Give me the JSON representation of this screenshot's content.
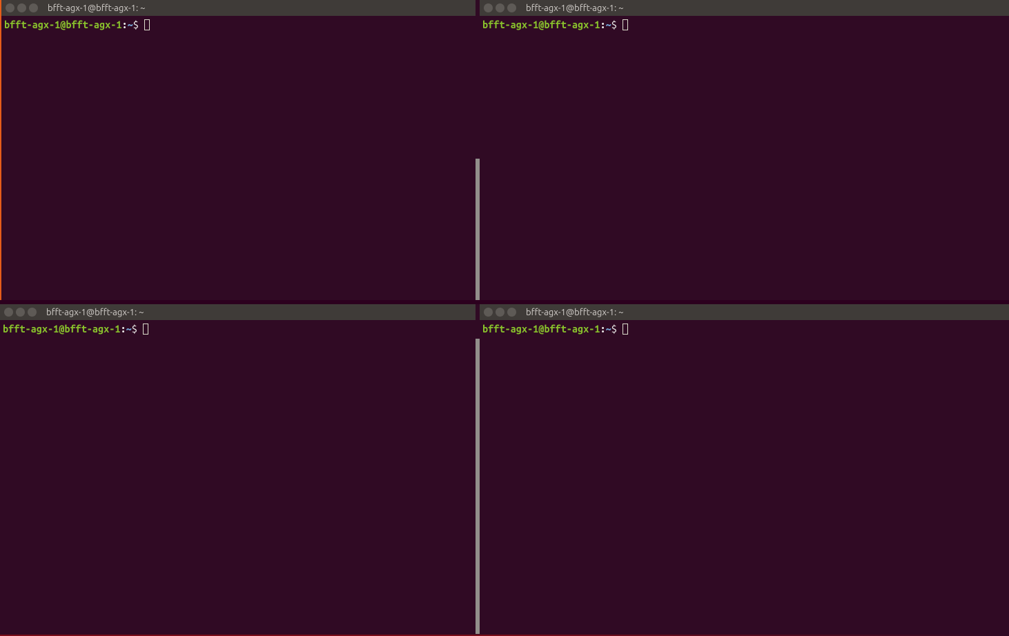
{
  "panes": {
    "tl": {
      "title": "bfft-agx-1@bfft-agx-1: ~",
      "prompt_user": "bfft-agx-1@bfft-agx-1",
      "prompt_colon": ":",
      "prompt_path": "~",
      "prompt_dollar": "$"
    },
    "tr": {
      "title": "bfft-agx-1@bfft-agx-1: ~",
      "prompt_user": "bfft-agx-1@bfft-agx-1",
      "prompt_colon": ":",
      "prompt_path": "~",
      "prompt_dollar": "$"
    },
    "bl": {
      "title": "bfft-agx-1@bfft-agx-1: ~",
      "prompt_user": "bfft-agx-1@bfft-agx-1",
      "prompt_colon": ":",
      "prompt_path": "~",
      "prompt_dollar": "$"
    },
    "br": {
      "title": "bfft-agx-1@bfft-agx-1: ~",
      "prompt_user": "bfft-agx-1@bfft-agx-1",
      "prompt_colon": ":",
      "prompt_path": "~",
      "prompt_dollar": "$"
    }
  }
}
